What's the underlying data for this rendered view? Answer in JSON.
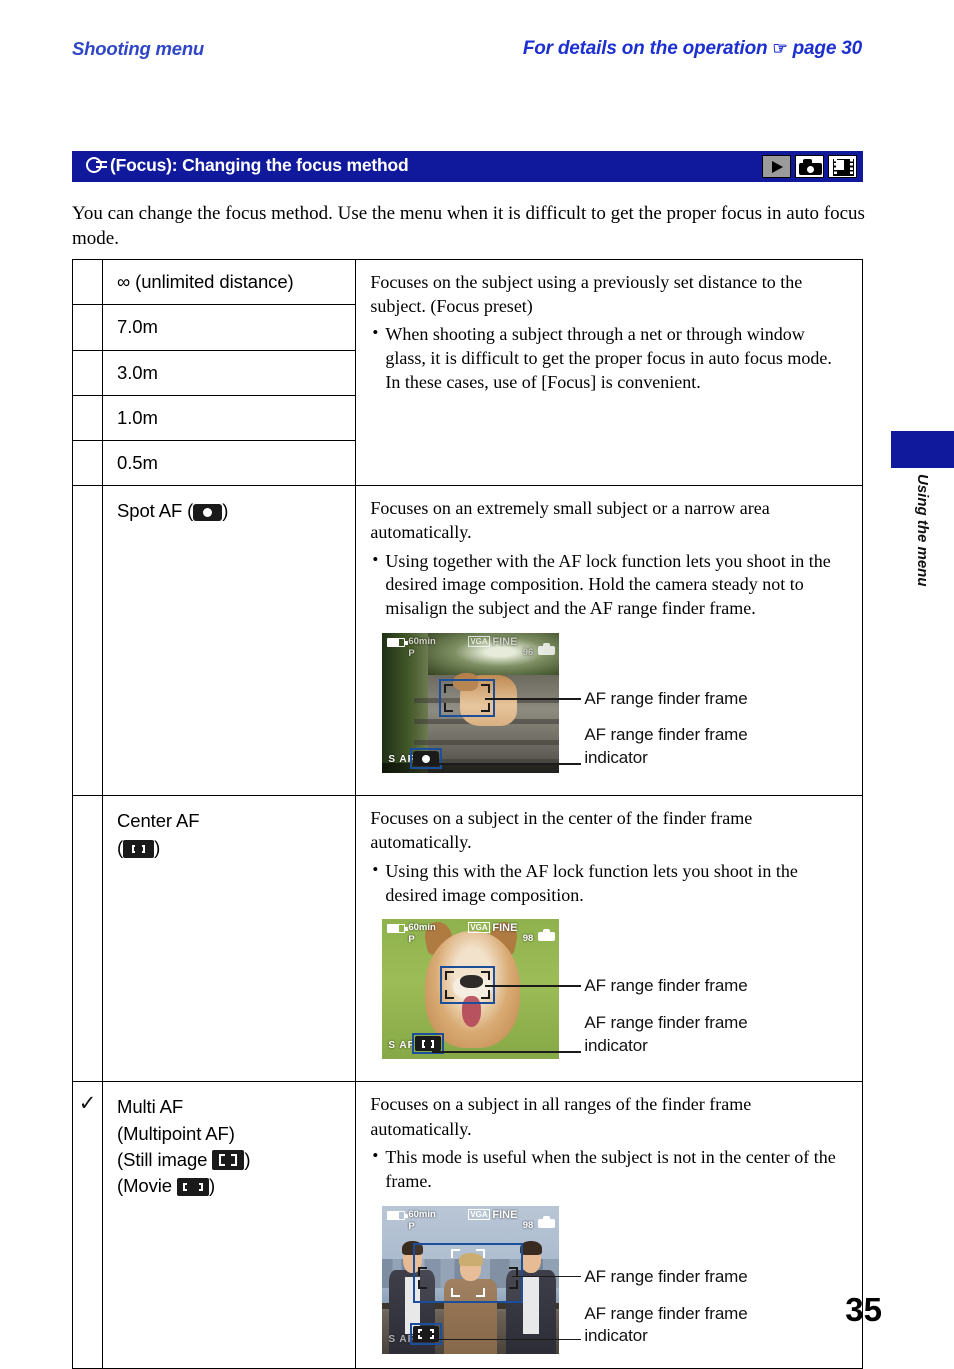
{
  "running_head": {
    "left": "Shooting menu",
    "right_prefix": "For details on the operation",
    "right_pointer": "☞",
    "right_suffix": "page 30"
  },
  "section": {
    "title": "(Focus): Changing the focus method",
    "title_icon": "focus-finger-icon",
    "mode_icons": [
      {
        "name": "playback-mode-icon",
        "state": "inactive"
      },
      {
        "name": "still-camera-mode-icon",
        "state": "active"
      },
      {
        "name": "movie-mode-icon",
        "state": "active"
      }
    ]
  },
  "intro": "You can change the focus method. Use the menu when it is difficult to get the proper focus in auto focus mode.",
  "table": {
    "rows": [
      {
        "marker": "",
        "option": "∞ (unlimited distance)",
        "group_start": true
      },
      {
        "marker": "",
        "option": "7.0m"
      },
      {
        "marker": "",
        "option": "3.0m"
      },
      {
        "marker": "",
        "option": "1.0m"
      },
      {
        "marker": "",
        "option": "0.5m"
      }
    ],
    "group1_description": {
      "paragraph": "Focuses on the subject using a previously set distance to the subject. (Focus preset)",
      "bullets": [
        "When shooting a subject through a net or through window glass, it is difficult to get the proper focus in auto focus mode. In these cases, use of [Focus] is convenient."
      ]
    },
    "spot_af": {
      "marker": "",
      "option_prefix": "Spot AF (",
      "option_suffix": ")",
      "option_icon": "spot-af-icon",
      "paragraph": "Focuses on an extremely small subject or a narrow area automatically.",
      "bullets": [
        "Using together with the AF lock function lets you shoot in the desired image composition. Hold the camera steady not to misalign the subject and the AF range finder frame."
      ],
      "figure": {
        "scene": "dog-on-stone-steps",
        "osd": {
          "battery": "battery-icon",
          "minutes": "60min",
          "mode": "P",
          "image_size": "VGA",
          "quality": "FINE",
          "shots_remaining": "96",
          "media": "memory-card-icon",
          "focus_status": "S AF",
          "indicator_icon": "spot-af-icon"
        },
        "callouts": [
          "AF range finder frame",
          "AF range finder frame\nindicator"
        ]
      }
    },
    "center_af": {
      "marker": "",
      "option_line1": "Center AF",
      "option_line2_prefix": "(",
      "option_line2_suffix": ")",
      "option_icon": "center-af-icon",
      "paragraph": "Focuses on a subject in the center of the finder frame automatically.",
      "bullets": [
        "Using this with the AF lock function lets you shoot in the desired image composition."
      ],
      "figure": {
        "scene": "dog-face-closeup",
        "osd": {
          "battery": "battery-icon",
          "minutes": "60min",
          "mode": "P",
          "image_size": "VGA",
          "quality": "FINE",
          "shots_remaining": "98",
          "media": "memory-card-icon",
          "focus_status": "S AF",
          "indicator_icon": "center-af-icon"
        },
        "callouts": [
          "AF range finder frame",
          "AF range finder frame\nindicator"
        ]
      }
    },
    "multi_af": {
      "marker": "✓",
      "option_line1": "Multi AF",
      "option_line2": "(Multipoint AF)",
      "option_line3_prefix": "(Still image",
      "option_line3_suffix": ")",
      "option_line3_icon": "multi-af-still-icon",
      "option_line4_prefix": "(Movie",
      "option_line4_suffix": ")",
      "option_line4_icon": "multi-af-movie-icon",
      "paragraph": "Focuses on a subject in all ranges of the finder frame automatically.",
      "bullets": [
        "This mode is useful when the subject is not in the center of the frame."
      ],
      "figure": {
        "scene": "three-people-with-city-skyline",
        "osd": {
          "battery": "battery-icon",
          "minutes": "60min",
          "mode": "P",
          "image_size": "VGA",
          "quality": "FINE",
          "shots_remaining": "98",
          "media": "memory-card-icon",
          "focus_status": "S AF",
          "indicator_icon": "multi-af-still-icon"
        },
        "callouts": [
          "AF range finder frame",
          "AF range finder frame\nindicator"
        ]
      }
    }
  },
  "side_tab": {
    "label": "Using the menu",
    "color": "#10189c"
  },
  "page_number": "35",
  "colors": {
    "accent_blue": "#10189c",
    "head_blue": "#2338c8",
    "af_frame_blue": "#1b4f9c"
  }
}
